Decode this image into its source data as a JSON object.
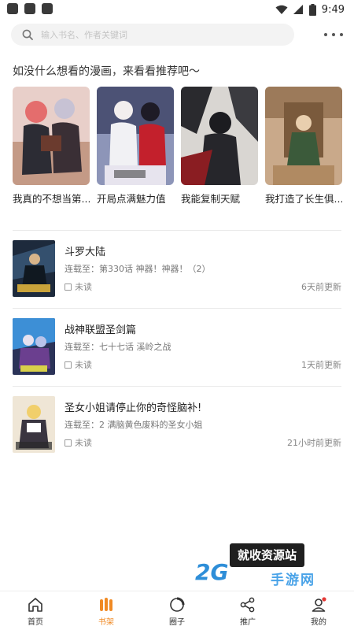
{
  "status_bar": {
    "time": "9:49"
  },
  "search": {
    "placeholder": "输入书名、作者关键词"
  },
  "recommend": {
    "title": "如没什么想看的漫画，来看看推荐吧～",
    "items": [
      {
        "name": "我真的不想当第..."
      },
      {
        "name": "开局点满魅力值"
      },
      {
        "name": "我能复制天赋"
      },
      {
        "name": "我打造了长生俱..."
      }
    ]
  },
  "shelf": {
    "items": [
      {
        "title": "斗罗大陆",
        "progress": "连载至：第330话 神器！神器！（2）",
        "read_status": "未读",
        "updated": "6天前更新"
      },
      {
        "title": "战神联盟圣剑篇",
        "progress": "连载至：七十七话 溪岭之战",
        "read_status": "未读",
        "updated": "1天前更新"
      },
      {
        "title": "圣女小姐请停止你的奇怪脑补!",
        "progress": "连载至：2 满脑黄色废料的圣女小姐",
        "read_status": "未读",
        "updated": "21小时前更新"
      }
    ]
  },
  "watermark": {
    "box": "就收资源站",
    "logo": "2G",
    "sub": "手游网"
  },
  "tabs": [
    {
      "label": "首页",
      "icon": "home-icon"
    },
    {
      "label": "书架",
      "icon": "bookshelf-icon",
      "active": true
    },
    {
      "label": "圈子",
      "icon": "circle-icon"
    },
    {
      "label": "推广",
      "icon": "share-icon"
    },
    {
      "label": "我的",
      "icon": "profile-icon"
    }
  ],
  "colors": {
    "accent": "#f08a24",
    "notify_dot": "#e53935"
  }
}
